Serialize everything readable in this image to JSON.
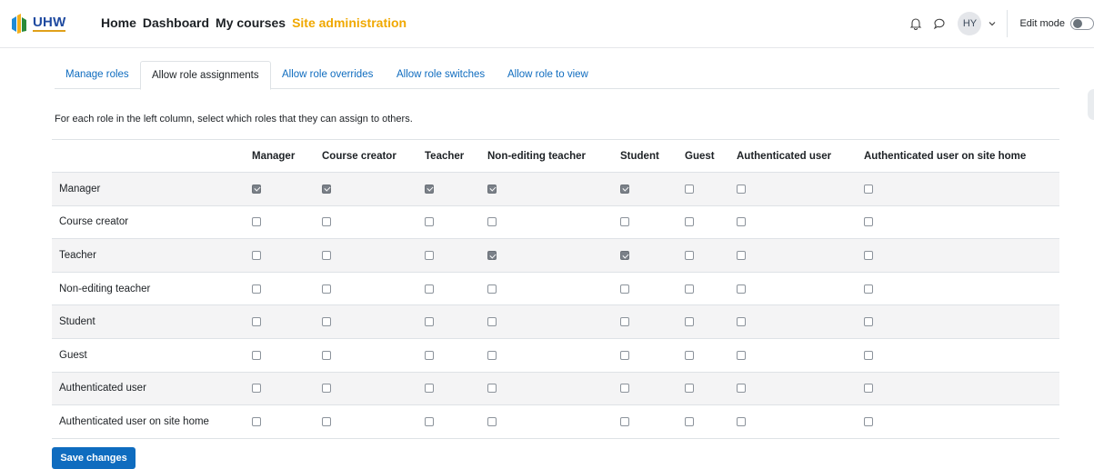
{
  "brand": {
    "logo_text": "UHW",
    "colors": {
      "primary": "#0f6cbf",
      "active_nav": "#f0a800"
    }
  },
  "nav": {
    "items": [
      {
        "label": "Home"
      },
      {
        "label": "Dashboard"
      },
      {
        "label": "My courses"
      },
      {
        "label": "Site administration",
        "active": true
      }
    ]
  },
  "user_menu": {
    "initials": "HY",
    "edit_mode_label": "Edit mode",
    "edit_mode_on": false
  },
  "tabs": [
    {
      "label": "Manage roles"
    },
    {
      "label": "Allow role assignments",
      "active": true
    },
    {
      "label": "Allow role overrides"
    },
    {
      "label": "Allow role switches"
    },
    {
      "label": "Allow role to view"
    }
  ],
  "description": "For each role in the left column, select which roles that they can assign to others.",
  "table": {
    "columns": [
      "Manager",
      "Course creator",
      "Teacher",
      "Non-editing teacher",
      "Student",
      "Guest",
      "Authenticated user",
      "Authenticated user on site home"
    ],
    "rows": [
      {
        "role": "Manager",
        "checks": [
          true,
          true,
          true,
          true,
          true,
          false,
          false,
          false
        ]
      },
      {
        "role": "Course creator",
        "checks": [
          false,
          false,
          false,
          false,
          false,
          false,
          false,
          false
        ]
      },
      {
        "role": "Teacher",
        "checks": [
          false,
          false,
          false,
          true,
          true,
          false,
          false,
          false
        ]
      },
      {
        "role": "Non-editing teacher",
        "checks": [
          false,
          false,
          false,
          false,
          false,
          false,
          false,
          false
        ]
      },
      {
        "role": "Student",
        "checks": [
          false,
          false,
          false,
          false,
          false,
          false,
          false,
          false
        ]
      },
      {
        "role": "Guest",
        "checks": [
          false,
          false,
          false,
          false,
          false,
          false,
          false,
          false
        ]
      },
      {
        "role": "Authenticated user",
        "checks": [
          false,
          false,
          false,
          false,
          false,
          false,
          false,
          false
        ]
      },
      {
        "role": "Authenticated user on site home",
        "checks": [
          false,
          false,
          false,
          false,
          false,
          false,
          false,
          false
        ]
      }
    ]
  },
  "save_button": {
    "label": "Save changes"
  }
}
